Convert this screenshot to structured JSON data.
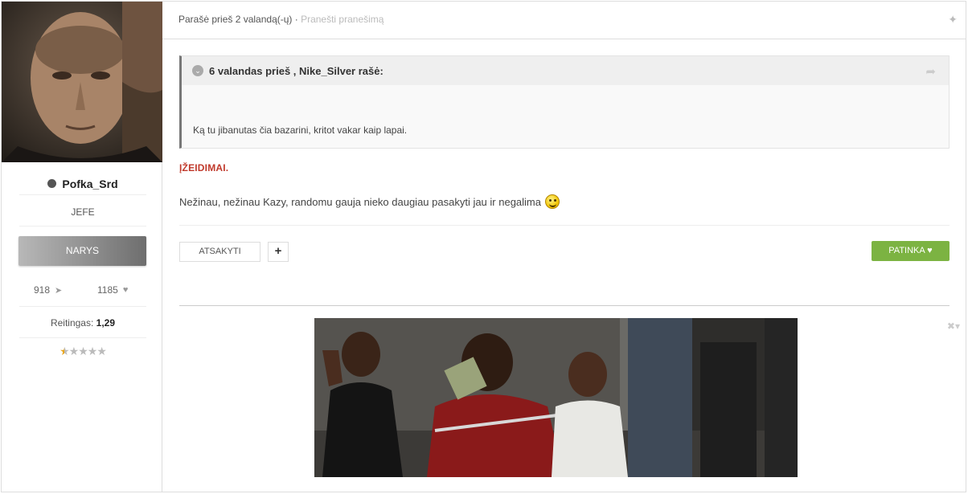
{
  "sidebar": {
    "username": "Pofka_Srd",
    "rank_title": "JEFE",
    "group": "NARYS",
    "posts_count": "918",
    "likes_count": "1185",
    "rating_label": "Reitingas:",
    "rating_value": "1,29",
    "stars_filled": 0.5,
    "stars_total": 5
  },
  "post": {
    "meta": "Parašė prieš 2 valandą(-ų) ·",
    "report_link": "Pranešti pranešimą",
    "quote": {
      "cite": "6 valandas prieš , Nike_Silver rašė:",
      "text": "Ką tu jibanutas čia bazarini, kritot vakar kaip lapai."
    },
    "heading": "ĮŽEIDIMAI.",
    "body": "Nežinau, nežinau Kazy, randomu gauja nieko daugiau pasakyti jau ir negalima",
    "reply_label": "ATSAKYTI",
    "like_label": "PATINKA"
  },
  "colors": {
    "accent_green": "#7cb342",
    "heading_red": "#c0392b"
  }
}
